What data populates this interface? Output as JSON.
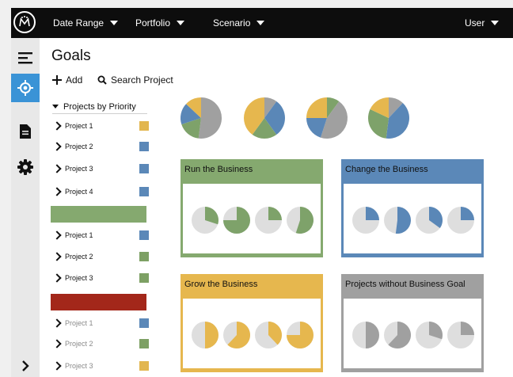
{
  "app": {
    "logo_icon": "monogram-logo-icon"
  },
  "topbar": {
    "menus": [
      {
        "label": "Date Range"
      },
      {
        "label": "Portfolio"
      },
      {
        "label": "Scenario"
      }
    ],
    "user_label": "User"
  },
  "rail": {
    "items": [
      {
        "icon": "hamburger-menu-icon"
      },
      {
        "icon": "target-icon",
        "active": true
      },
      {
        "icon": "document-icon"
      },
      {
        "icon": "gear-icon"
      }
    ],
    "expand_icon": "chevron-right-icon"
  },
  "page": {
    "title": "Goals"
  },
  "toolbar": {
    "add_label": "Add",
    "search_label": "Search Project"
  },
  "projects": {
    "header": "Projects by Priority",
    "groups": [
      {
        "band_color": null,
        "items": [
          {
            "name": "Project 1",
            "color": "#e2b64f"
          },
          {
            "name": "Project 2",
            "color": "#5b88b8"
          },
          {
            "name": "Project 3",
            "color": "#5b88b8"
          },
          {
            "name": "Project 4",
            "color": "#5b88b8"
          }
        ]
      },
      {
        "band_color": "#85a96f",
        "items": [
          {
            "name": "Project 1",
            "color": "#5b88b8"
          },
          {
            "name": "Project 2",
            "color": "#7da064"
          },
          {
            "name": "Project 3",
            "color": "#7da064"
          }
        ]
      },
      {
        "band_color": "#a3271a",
        "items": [
          {
            "name": "Project 1",
            "color": "#5b88b8",
            "faded": true
          },
          {
            "name": "Project 2",
            "color": "#7da064",
            "faded": true
          },
          {
            "name": "Project 3",
            "color": "#e2b64f",
            "faded": true
          }
        ]
      }
    ]
  },
  "colors": {
    "green": "#7ea26a",
    "blue": "#5a87b7",
    "yellow": "#e6b74e",
    "gray": "#a0a0a0",
    "light": "#dedede"
  },
  "summary_pies": [
    {
      "slices": [
        {
          "color": "gray",
          "value": 0.52
        },
        {
          "color": "green",
          "value": 0.18
        },
        {
          "color": "blue",
          "value": 0.17
        },
        {
          "color": "yellow",
          "value": 0.13
        }
      ]
    },
    {
      "slices": [
        {
          "color": "gray",
          "value": 0.1
        },
        {
          "color": "blue",
          "value": 0.3
        },
        {
          "color": "green",
          "value": 0.2
        },
        {
          "color": "yellow",
          "value": 0.4
        }
      ]
    },
    {
      "slices": [
        {
          "color": "green",
          "value": 0.1
        },
        {
          "color": "gray",
          "value": 0.45
        },
        {
          "color": "blue",
          "value": 0.2
        },
        {
          "color": "yellow",
          "value": 0.25
        }
      ]
    },
    {
      "slices": [
        {
          "color": "gray",
          "value": 0.12
        },
        {
          "color": "blue",
          "value": 0.4
        },
        {
          "color": "green",
          "value": 0.3
        },
        {
          "color": "yellow",
          "value": 0.18
        }
      ]
    }
  ],
  "goals": [
    {
      "title": "Run the Business",
      "header_color": "#85a96f",
      "border_color": "#85a96f",
      "pie_color": "green",
      "fills": [
        0.3,
        0.75,
        0.25,
        0.55
      ]
    },
    {
      "title": "Change the Business",
      "header_color": "#5b88b8",
      "border_color": "#5b88b8",
      "pie_color": "blue",
      "fills": [
        0.25,
        0.52,
        0.35,
        0.25
      ]
    },
    {
      "title": "Grow the Business",
      "header_color": "#e6b74e",
      "border_color": "#e6b74e",
      "pie_color": "yellow",
      "fills": [
        0.5,
        0.62,
        0.38,
        0.75
      ]
    },
    {
      "title": "Projects without Business Goal",
      "header_color": "#a0a0a0",
      "border_color": "#a0a0a0",
      "pie_color": "gray",
      "fills": [
        0.5,
        0.62,
        0.3,
        0.25
      ]
    }
  ]
}
